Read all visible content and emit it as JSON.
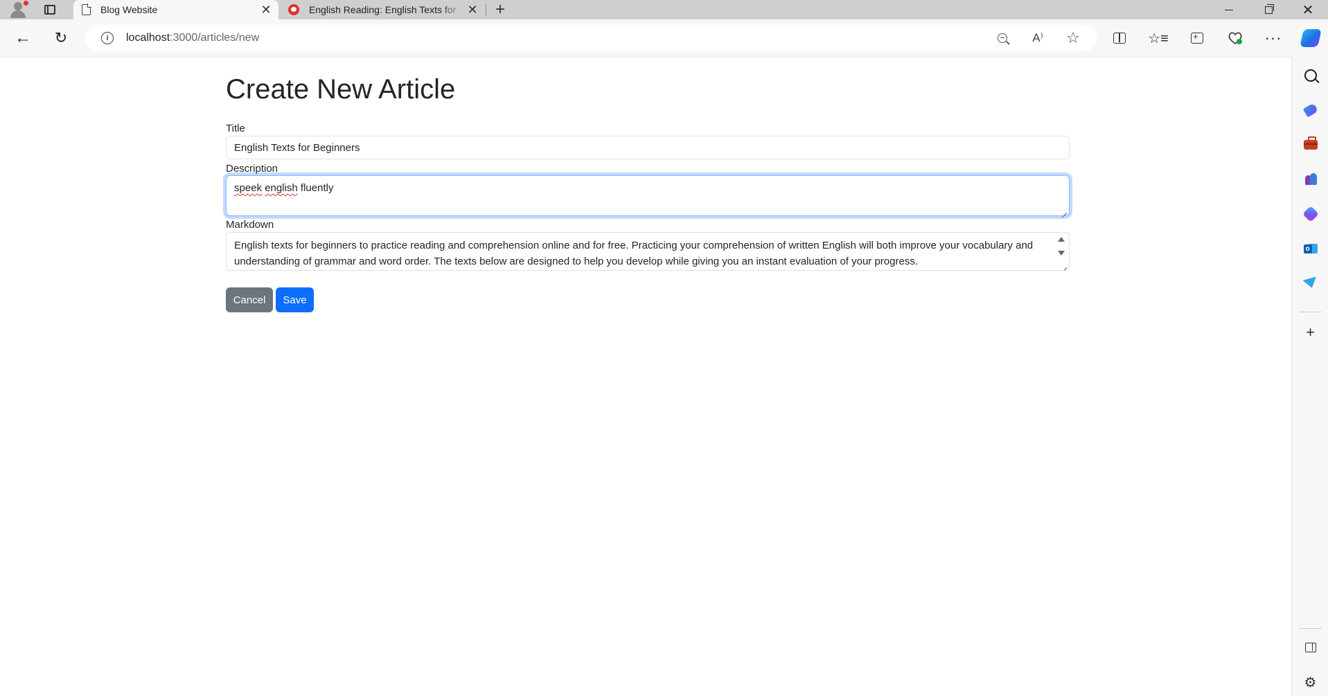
{
  "browser": {
    "tabs": [
      {
        "label": "Blog Website",
        "active": true
      },
      {
        "label": "English Reading: English Texts for",
        "active": false
      }
    ],
    "address": {
      "host": "localhost",
      "path": ":3000/articles/new"
    },
    "icons": {
      "profile": "profile-avatar-icon",
      "tab_actions": "tab-actions-icon",
      "new_tab": "+",
      "back": "←",
      "refresh": "↻",
      "info": "i",
      "read_aloud": "A⁾",
      "favorite": "☆",
      "favorites_list": "☆≡",
      "more": "···",
      "window_close": "✕",
      "tab_close": "✕",
      "add": "+",
      "settings": "⚙"
    }
  },
  "page": {
    "heading": "Create New Article",
    "fields": {
      "title": {
        "label": "Title",
        "value": "English Texts for Beginners"
      },
      "description": {
        "label": "Description",
        "value_misspelled_1": "speek",
        "value_space": " ",
        "value_misspelled_2": "english",
        "value_rest": " fluently"
      },
      "markdown": {
        "label": "Markdown",
        "value": "English texts for beginners to practice reading and comprehension online and for free. Practicing your comprehension of written English will both improve your vocabulary and understanding of grammar and word order. The texts below are designed to help you develop while giving you an instant evaluation of your progress."
      }
    },
    "buttons": {
      "cancel": "Cancel",
      "save": "Save"
    }
  },
  "colors": {
    "primary": "#0d6efd",
    "secondary": "#6c757d",
    "focus_ring": "#86b7fe",
    "tab_strip": "#cfcfcf",
    "toolbar": "#f7f7f7"
  }
}
